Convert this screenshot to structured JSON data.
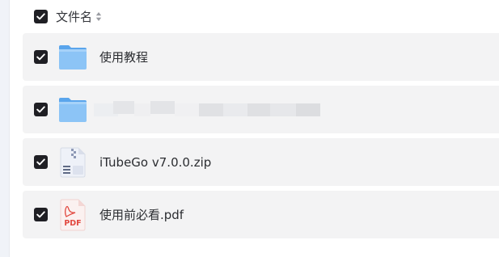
{
  "header": {
    "select_all_checked": true,
    "column_label": "文件名",
    "sort_icon": "sort-icon"
  },
  "files": [
    {
      "name": "使用教程",
      "type": "folder",
      "icon": "folder-icon",
      "checked": true
    },
    {
      "name": "",
      "type": "folder",
      "icon": "folder-icon",
      "checked": true,
      "name_obscured": true
    },
    {
      "name": "iTubeGo v7.0.0.zip",
      "type": "zip",
      "icon": "zip-file-icon",
      "checked": true
    },
    {
      "name": "使用前必看.pdf",
      "type": "pdf",
      "icon": "pdf-file-icon",
      "checked": true,
      "icon_label": "PDF"
    }
  ],
  "colors": {
    "checkbox": "#1f1f24",
    "row_background": "#f3f3f4",
    "folder": "#7cb8f2",
    "pdf_red": "#e2483f"
  }
}
